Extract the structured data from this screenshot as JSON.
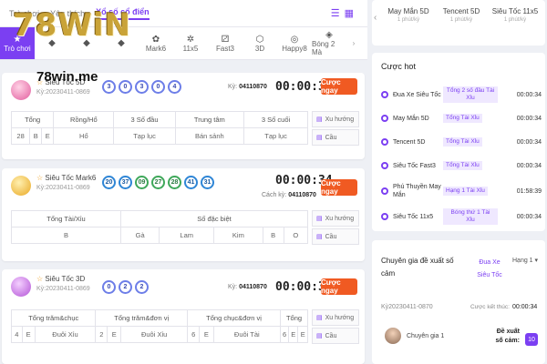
{
  "logo": {
    "mark": "78WiN",
    "site": "78win.me"
  },
  "topbar": {
    "tabs": [
      "Trò chơi",
      "Yêu thích",
      "Xổ số cổ điển"
    ]
  },
  "game_tabs": [
    "Trò chơi",
    "",
    "",
    "",
    "Mark6",
    "11x5",
    "Fast3",
    "3D",
    "Happy8",
    "Bóng 2 Mà"
  ],
  "cards": [
    {
      "name": "Siêu Tốc 5D",
      "ky": "Kỳ:20230411-0869",
      "balls": [
        "3",
        "0",
        "3",
        "0",
        "4"
      ],
      "ky_label": "Kỳ:",
      "ky_val": "04110870",
      "timer": "00:00:34",
      "button": "Cược ngay",
      "headers": [
        "Tổng",
        "Rồng/Hổ",
        "3 Số đầu",
        "Trung tâm",
        "3 Số cuối"
      ],
      "row": [
        "28",
        "B",
        "E",
        "Hổ",
        "Tạp lục",
        "Bán sảnh",
        "Tạp lục"
      ],
      "side": [
        "Xu hướng",
        "Cầu"
      ]
    },
    {
      "name": "Siêu Tốc Mark6",
      "ky": "Kỳ:20230411-0869",
      "balls": [
        "20",
        "37",
        "09",
        "27",
        "28",
        "41",
        "31"
      ],
      "ky_label": "Cách kỳ:",
      "ky_val": "04110870",
      "timer": "00:00:34",
      "button": "Cược ngay",
      "headers": [
        "Tổng Tài/Xỉu",
        "Số đặc biệt"
      ],
      "row": [
        "B",
        "Gà",
        "Lam",
        "Kim",
        "B",
        "O"
      ],
      "side": [
        "Xu hướng",
        "Cầu"
      ]
    },
    {
      "name": "Siêu Tốc 3D",
      "ky": "Kỳ:20230411-0869",
      "balls": [
        "0",
        "2",
        "2"
      ],
      "ky_label": "Kỳ:",
      "ky_val": "04110870",
      "timer": "00:00:34",
      "button": "Cược ngay",
      "headers": [
        "Tổng trăm&chục",
        "Tổng trăm&đơn vị",
        "Tổng chục&đơn vị",
        "Tổng"
      ],
      "row": [
        "4",
        "E",
        "Đuôi Xỉu",
        "2",
        "E",
        "Đuôi Xỉu",
        "6",
        "E",
        "Đuôi Tài",
        "6",
        "E",
        "E"
      ],
      "side": [
        "Xu hướng",
        "Cầu"
      ]
    }
  ],
  "right": {
    "stats": [
      {
        "name": "May Mắn 5D",
        "sub": "1 phút/kỳ"
      },
      {
        "name": "Tencent 5D",
        "sub": "1 phút/kỳ"
      },
      {
        "name": "Siêu Tốc 11x5",
        "sub": "1 phút/kỳ"
      }
    ],
    "hot_title": "Cược hot",
    "hot": [
      {
        "name": "Đua Xe Siêu Tốc",
        "tag": "Tổng 2 số đầu Tài Xỉu",
        "time": "00:00:34"
      },
      {
        "name": "May Mắn 5D",
        "tag": "Tổng Tài Xỉu",
        "time": "00:00:34"
      },
      {
        "name": "Tencent 5D",
        "tag": "Tổng Tài Xỉu",
        "time": "00:00:34"
      },
      {
        "name": "Siêu Tốc Fast3",
        "tag": "Tổng Tài Xỉu",
        "time": "00:00:34"
      },
      {
        "name": "Phú Thuyền May Mắn",
        "tag": "Hạng 1 Tài Xỉu",
        "time": "01:58:39"
      },
      {
        "name": "Siêu Tốc 11x5",
        "tag": "Bóng thứ 1 Tài Xỉu",
        "time": "00:00:34"
      }
    ],
    "expert": {
      "title": "Chuyên gia đề xuất số cảm",
      "game": "Đua Xe Siêu Tốc",
      "rank": "Hạng 1",
      "ky": "Kỳ20230411-0870",
      "end_label": "Cược kết thúc:",
      "end_time": "00:00:34",
      "expert_name": "Chuyên gia 1",
      "propose_label": "Đề xuất số cảm:",
      "propose_val": "10"
    }
  }
}
